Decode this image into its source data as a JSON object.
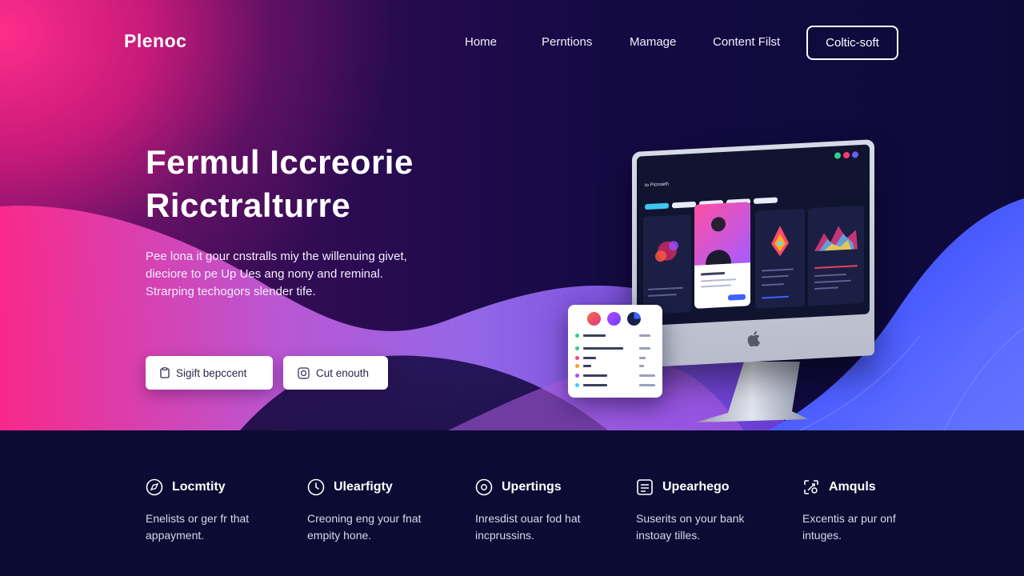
{
  "brand": {
    "logo": "Plenoc"
  },
  "nav": {
    "items": [
      "Home",
      "Perntions",
      "Mamage",
      "Content Filst"
    ],
    "cta": "Coltic-soft"
  },
  "hero": {
    "title_lines": [
      "Fermul Iccreorie",
      "Ricctralturre"
    ],
    "description_lines": [
      "Pee lona it gour cnstralls miy the willenuing givet,",
      "dieciore to pe Up Ues ang nony and reminal.",
      "Strarping techogors slender tife."
    ],
    "buttons": [
      {
        "label": "Sigift bepccent",
        "icon": "clipboard-icon"
      },
      {
        "label": "Cut enouth",
        "icon": "target-icon"
      }
    ]
  },
  "monitor": {
    "screen_brand": "to Picnoeth",
    "logo_icon": "apple-logo-icon"
  },
  "features": [
    {
      "title": "Locmtity",
      "icon": "compass-icon",
      "desc_lines": [
        "Enelists or ger fr that",
        "appayment."
      ]
    },
    {
      "title": "Ulearfigty",
      "icon": "timer-icon",
      "desc_lines": [
        "Creoning eng your fnat",
        "empity hone."
      ]
    },
    {
      "title": "Upertings",
      "icon": "gear-icon",
      "desc_lines": [
        "Inresdist ouar fod hat",
        "incprussins."
      ]
    },
    {
      "title": "Upearhego",
      "icon": "document-icon",
      "desc_lines": [
        "Suserits on your bank",
        "instoay tilles."
      ]
    },
    {
      "title": "Amquls",
      "icon": "tools-icon",
      "desc_lines": [
        "Excentis ar pur onf",
        "intuges."
      ]
    }
  ],
  "colors": {
    "accent_pink": "#ff2d8a",
    "accent_purple": "#9b59ff",
    "accent_blue": "#3d5bff",
    "dark_bg": "#0b0b33"
  }
}
